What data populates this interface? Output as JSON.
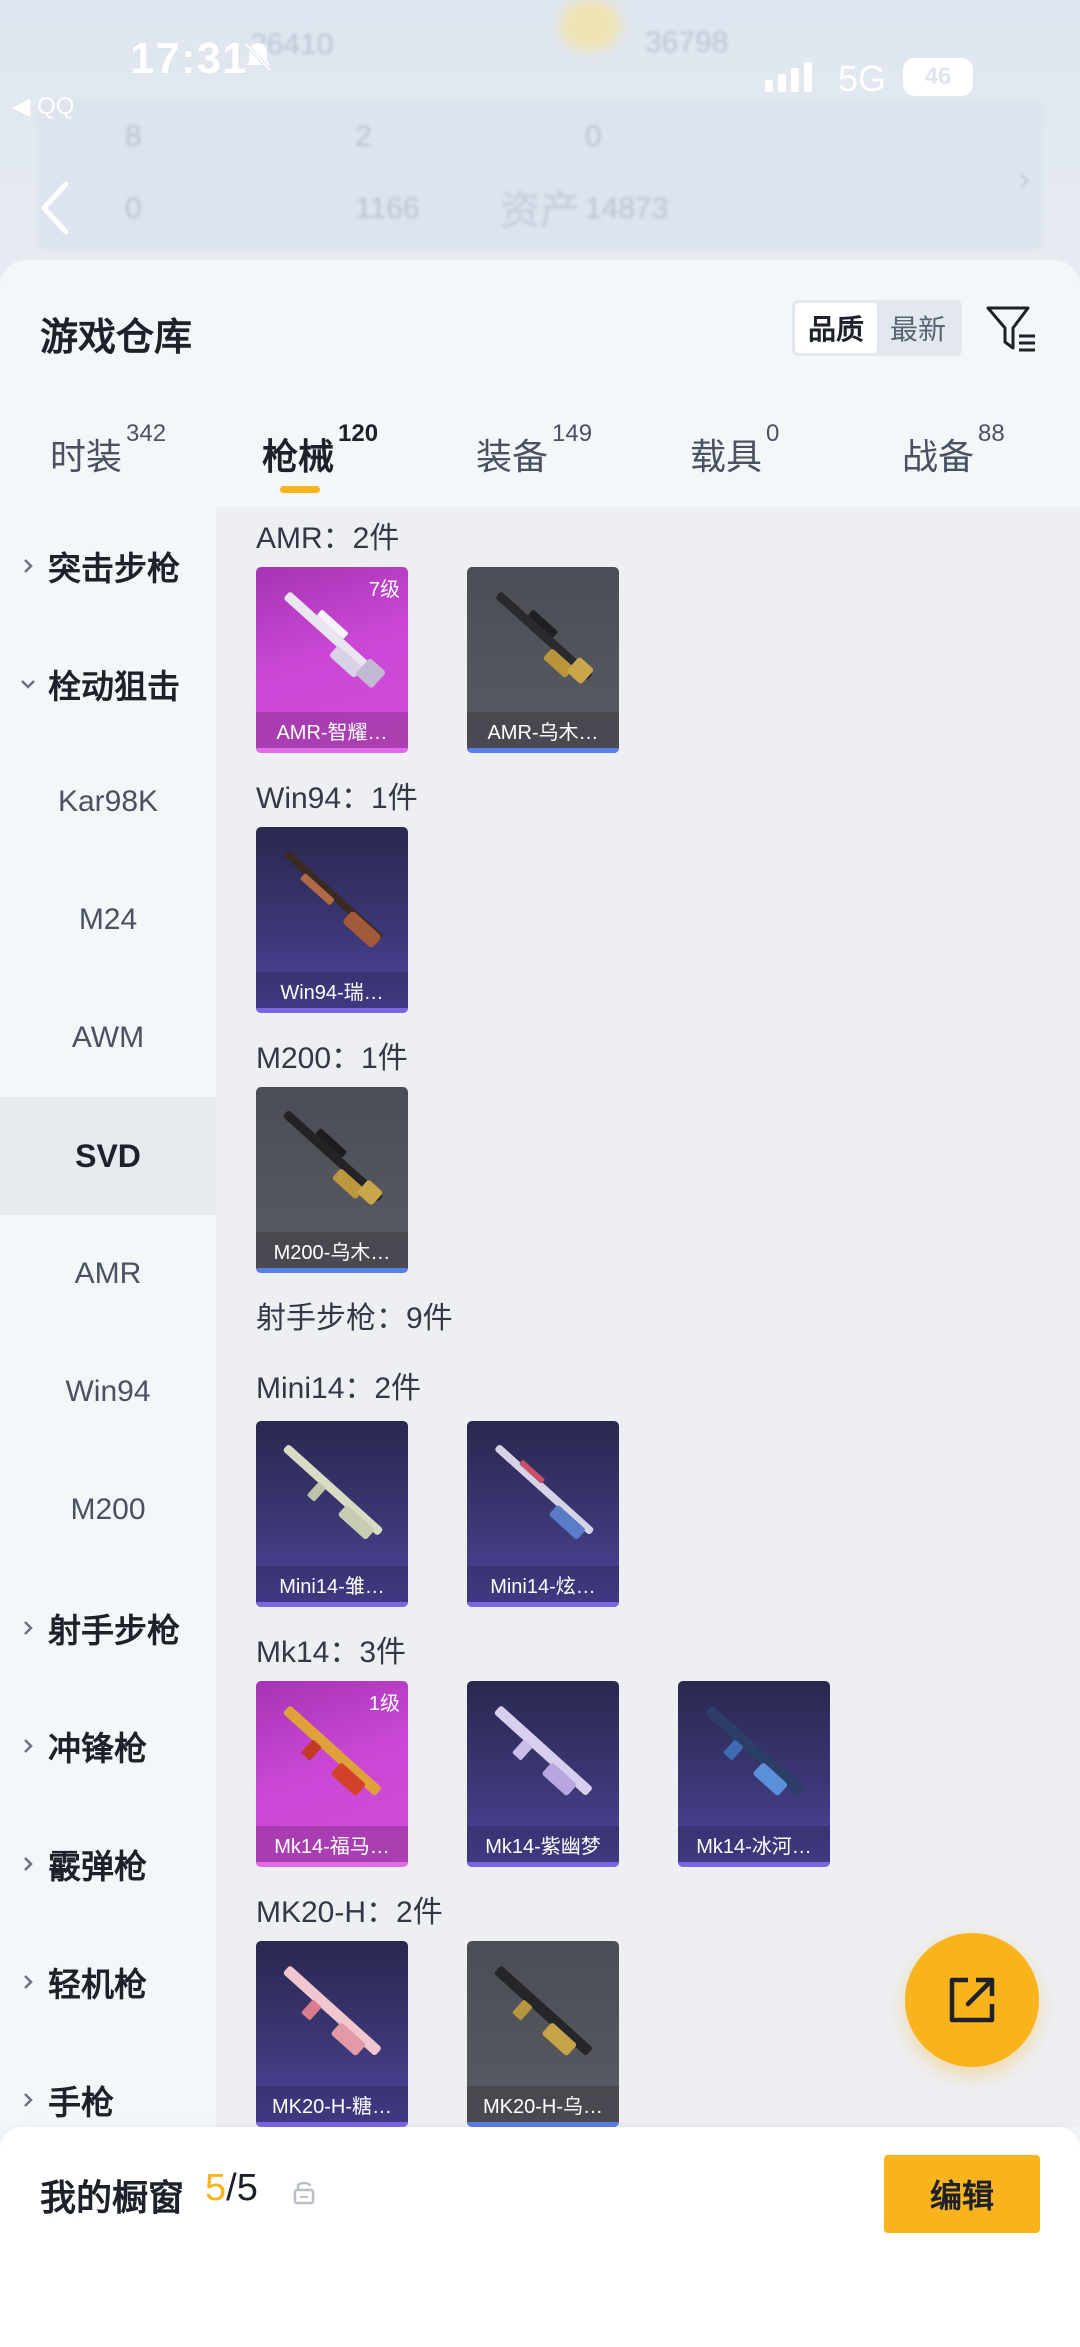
{
  "status_bar": {
    "time": "17:31",
    "back_app": "QQ",
    "network": "5G",
    "battery": "46"
  },
  "background": {
    "blurred_numbers": [
      "26410",
      "36798",
      "8",
      "2",
      "0",
      "0",
      "1166",
      "14873"
    ],
    "title": "资产"
  },
  "header": {
    "title": "游戏仓库",
    "sort_options": [
      "品质",
      "最新"
    ],
    "active_sort": "品质"
  },
  "tabs": [
    {
      "label": "时装",
      "count": "342"
    },
    {
      "label": "枪械",
      "count": "120"
    },
    {
      "label": "装备",
      "count": "149"
    },
    {
      "label": "载具",
      "count": "0"
    },
    {
      "label": "战备",
      "count": "88"
    }
  ],
  "active_tab": "枪械",
  "sidebar": [
    {
      "label": "突击步枪",
      "type": "group",
      "expanded": false
    },
    {
      "label": "栓动狙击",
      "type": "group",
      "expanded": true
    },
    {
      "label": "Kar98K",
      "type": "sub"
    },
    {
      "label": "M24",
      "type": "sub"
    },
    {
      "label": "AWM",
      "type": "sub"
    },
    {
      "label": "SVD",
      "type": "sub",
      "selected": true
    },
    {
      "label": "AMR",
      "type": "sub"
    },
    {
      "label": "Win94",
      "type": "sub"
    },
    {
      "label": "M200",
      "type": "sub"
    },
    {
      "label": "射手步枪",
      "type": "group",
      "expanded": false
    },
    {
      "label": "冲锋枪",
      "type": "group",
      "expanded": false
    },
    {
      "label": "霰弹枪",
      "type": "group",
      "expanded": false
    },
    {
      "label": "轻机枪",
      "type": "group",
      "expanded": false
    },
    {
      "label": "手枪",
      "type": "group",
      "expanded": false
    }
  ],
  "content": {
    "sections": [
      {
        "label": "AMR：2件",
        "items": [
          {
            "name": "AMR-智耀…",
            "level": "7级",
            "rarity": "pink"
          },
          {
            "name": "AMR-乌木…",
            "rarity": "gray"
          }
        ]
      },
      {
        "label": "Win94：1件",
        "items": [
          {
            "name": "Win94-瑞…",
            "rarity": "purple"
          }
        ]
      },
      {
        "label": "M200：1件",
        "items": [
          {
            "name": "M200-乌木…",
            "rarity": "gray"
          }
        ]
      },
      {
        "label": "射手步枪：9件",
        "items": []
      },
      {
        "label": "Mini14：2件",
        "items": [
          {
            "name": "Mini14-雏…",
            "rarity": "purple"
          },
          {
            "name": "Mini14-炫…",
            "rarity": "purple"
          }
        ]
      },
      {
        "label": "Mk14：3件",
        "items": [
          {
            "name": "Mk14-福马…",
            "level": "1级",
            "rarity": "pink"
          },
          {
            "name": "Mk14-紫幽梦",
            "rarity": "purple"
          },
          {
            "name": "Mk14-冰河…",
            "rarity": "purple"
          }
        ]
      },
      {
        "label": "MK20-H：2件",
        "items": [
          {
            "name": "MK20-H-糖…",
            "rarity": "purple"
          },
          {
            "name": "MK20-H-乌…",
            "rarity": "gray"
          }
        ]
      }
    ]
  },
  "showcase": {
    "title": "我的橱窗",
    "current": "5",
    "total": "/5",
    "edit_label": "编辑"
  },
  "colors": {
    "accent": "#f8b31d",
    "pink_rarity": "#c947d4",
    "purple_rarity": "#3b3775",
    "gray_rarity": "#55575f"
  }
}
